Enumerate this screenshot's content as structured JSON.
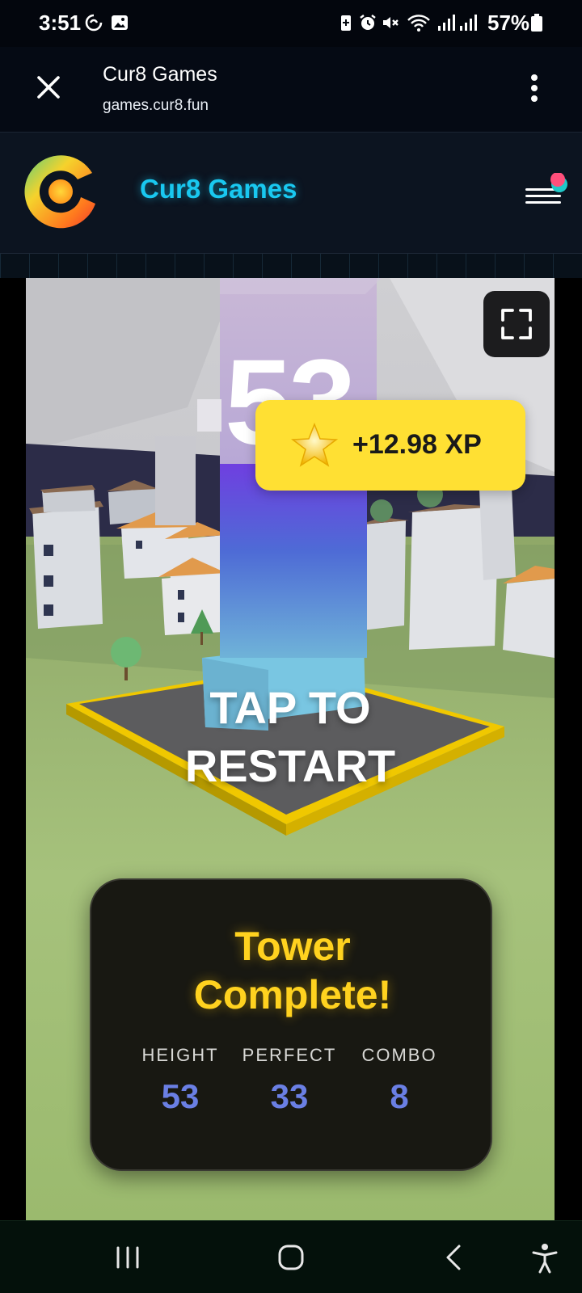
{
  "status_bar": {
    "time": "3:51",
    "battery_pct": "57%",
    "left_icons": [
      "sync-icon",
      "image-icon"
    ],
    "right_icons": [
      "battery-saver-icon",
      "alarm-icon",
      "mute-icon",
      "wifi-icon",
      "signal-icon",
      "signal-icon",
      "battery-icon"
    ]
  },
  "browser": {
    "title": "Cur8 Games",
    "url": "games.cur8.fun",
    "close_icon": "close-icon",
    "menu_icon": "more-vert-icon"
  },
  "site_header": {
    "brand_name": "Cur8 Games",
    "brand_color": "#19c8f0",
    "notification_colors": [
      "#ff4f7b",
      "#1fc8c8"
    ]
  },
  "game": {
    "score": "53",
    "xp_reward": "+12.98 XP",
    "tap_line1": "TAP TO",
    "tap_line2": "RESTART",
    "result": {
      "title_line1": "Tower",
      "title_line2": "Complete!",
      "stats": [
        {
          "label": "HEIGHT",
          "value": "53"
        },
        {
          "label": "PERFECT",
          "value": "33"
        },
        {
          "label": "COMBO",
          "value": "8"
        }
      ]
    },
    "accent_colors": {
      "xp_toast": "#ffe033",
      "title": "#ffd21f",
      "stat_value": "#6a7fe4"
    }
  },
  "nav_bar": {
    "icons": [
      "recents-icon",
      "home-icon",
      "back-icon",
      "accessibility-icon"
    ]
  }
}
